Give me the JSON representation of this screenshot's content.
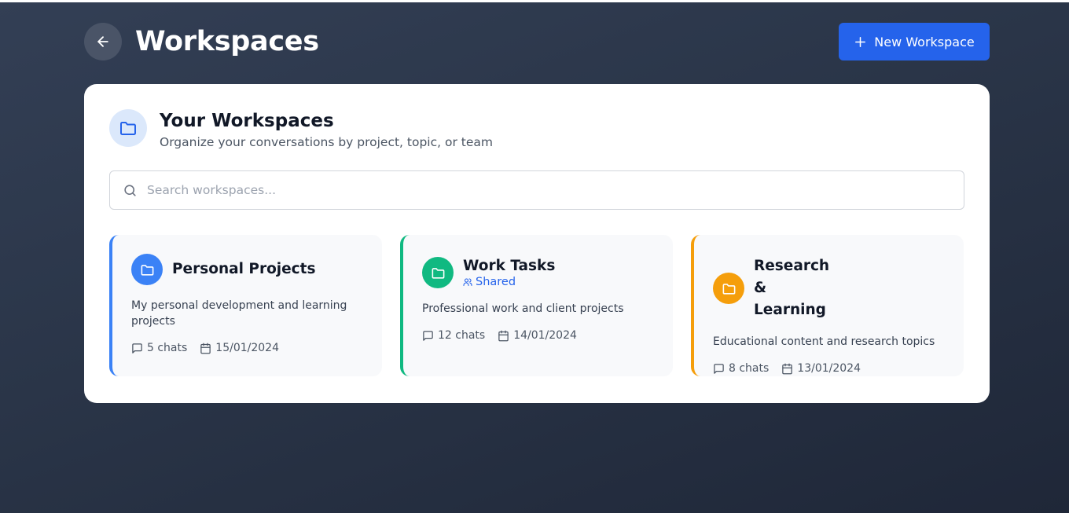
{
  "header": {
    "title": "Workspaces",
    "new_button_label": "New Workspace"
  },
  "panel": {
    "title": "Your Workspaces",
    "subtitle": "Organize your conversations by project, topic, or team"
  },
  "search": {
    "placeholder": "Search workspaces...",
    "value": ""
  },
  "workspaces": [
    {
      "title": "Personal Projects",
      "shared_label": "",
      "description": "My personal development and learning projects",
      "chats": "5 chats",
      "date": "15/01/2024",
      "color": "#3b82f6",
      "icon": "folder-icon"
    },
    {
      "title": "Work Tasks",
      "shared_label": "Shared",
      "description": "Professional work and client projects",
      "chats": "12 chats",
      "date": "14/01/2024",
      "color": "#10b981",
      "icon": "folder-icon"
    },
    {
      "title": "Research & Learning",
      "shared_label": "",
      "description": "Educational content and research topics",
      "chats": "8 chats",
      "date": "13/01/2024",
      "color": "#f59e0b",
      "icon": "folder-icon"
    }
  ],
  "colors": {
    "accent": "#2563eb",
    "panel_icon_bg": "#dbe8fb"
  }
}
